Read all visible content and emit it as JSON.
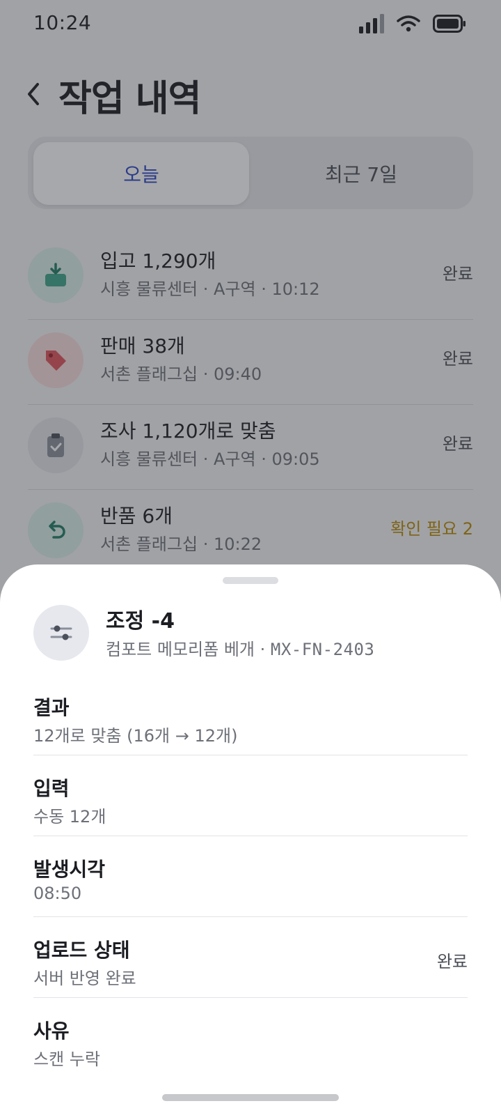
{
  "status_bar": {
    "time": "10:24"
  },
  "header": {
    "title": "작업 내역"
  },
  "tabs": [
    {
      "label": "오늘",
      "active": true
    },
    {
      "label": "최근 7일",
      "active": false
    }
  ],
  "records": [
    {
      "title": "입고 1,290개",
      "subtitle": "시흥 물류센터 · A구역 · 10:12",
      "status": "완료",
      "icon": "inbound-icon",
      "color": "#3da58a"
    },
    {
      "title": "판매 38개",
      "subtitle": "서촌 플래그십 · 09:40",
      "status": "완료",
      "icon": "tag-icon",
      "color": "#e0535a"
    },
    {
      "title": "조사 1,120개로 맞춤",
      "subtitle": "시흥 물류센터 · A구역 · 09:05",
      "status": "완료",
      "icon": "clipboard-check-icon",
      "color": "#6b7280"
    },
    {
      "title": "반품 6개",
      "subtitle": "서촌 플래그십 · 10:22",
      "status": "확인 필요 2",
      "icon": "return-icon",
      "color": "#3da58a"
    }
  ],
  "sheet": {
    "title": "조정 -4",
    "product": "컴포트 메모리폼 베개 · ",
    "sku": "MX-FN-2403",
    "icon": "sliders-icon",
    "details": [
      {
        "label": "결과",
        "value": "12개로 맞춤 (16개 → 12개)",
        "status": ""
      },
      {
        "label": "입력",
        "value": "수동 12개",
        "status": ""
      },
      {
        "label": "발생시각",
        "value": "08:50",
        "status": ""
      },
      {
        "label": "업로드 상태",
        "value": "서버 반영 완료",
        "status": "완료"
      },
      {
        "label": "사유",
        "value": "스캔 누락",
        "status": ""
      }
    ]
  }
}
